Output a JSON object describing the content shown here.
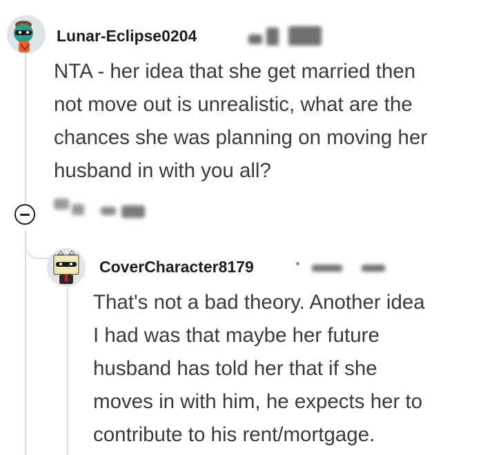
{
  "comments": [
    {
      "username": "Lunar-Eclipse0204",
      "body_lines": [
        "NTA - her idea that she get married then",
        "not move out is unrealistic, what are the",
        "chances she was planning on moving her",
        "husband in with you all?"
      ]
    },
    {
      "username": "CoverCharacter8179",
      "body_lines": [
        "That's not a bad theory. Another idea",
        "I had was that maybe her future",
        "husband has told her that if she",
        "moves in with him, he expects her to",
        "contribute to his rent/mortgage."
      ]
    }
  ],
  "icons": {
    "collapse": "minus-circle-icon",
    "avatar_1": "snoo-avatar-icon",
    "avatar_2": "snoo-avatar-icon"
  },
  "colors": {
    "text": "#1c1c1c",
    "body_text": "#3a3a3a",
    "thread_line": "#dcdcdc",
    "blurred_meta": "#6f6f6f"
  }
}
